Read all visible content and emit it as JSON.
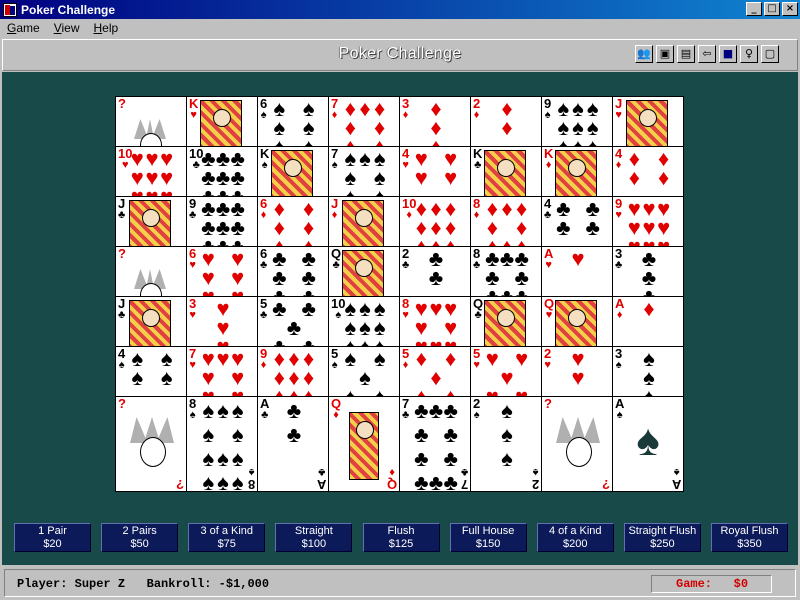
{
  "window": {
    "title": "Poker Challenge"
  },
  "menu": [
    "Game",
    "View",
    "Help"
  ],
  "header": {
    "title": "Poker Challenge"
  },
  "toolbar": [
    "players-icon",
    "cards-icon",
    "notepad-icon",
    "undo-icon",
    "save-icon",
    "hint-icon",
    "exit-icon"
  ],
  "cards": [
    [
      "?",
      "K♥",
      "6♠",
      "7♦",
      "3♦",
      "2♦",
      "9♠",
      "J♥"
    ],
    [
      "10♥",
      "10♣",
      "K♠",
      "7♠",
      "4♥",
      "K♣",
      "K♦",
      "4♦"
    ],
    [
      "J♣",
      "9♣",
      "6♦",
      "J♦",
      "10♦",
      "8♦",
      "4♣",
      "9♥"
    ],
    [
      "?",
      "6♥",
      "6♣",
      "Q♣",
      "2♣",
      "8♣",
      "A♥",
      "3♣"
    ],
    [
      "J♣",
      "3♥",
      "5♣",
      "10♠",
      "8♥",
      "Q♣",
      "Q♥",
      "A♦"
    ],
    [
      "4♠",
      "7♥",
      "9♦",
      "5♠",
      "5♦",
      "5♥",
      "2♥",
      "3♠"
    ],
    [
      "?",
      "8♠",
      "A♣",
      "Q♦",
      "7♣",
      "2♠",
      "?",
      "A♠"
    ]
  ],
  "hands": [
    {
      "name": "1 Pair",
      "payout": "$20"
    },
    {
      "name": "2 Pairs",
      "payout": "$50"
    },
    {
      "name": "3 of a Kind",
      "payout": "$75"
    },
    {
      "name": "Straight",
      "payout": "$100"
    },
    {
      "name": "Flush",
      "payout": "$125"
    },
    {
      "name": "Full House",
      "payout": "$150"
    },
    {
      "name": "4 of a Kind",
      "payout": "$200"
    },
    {
      "name": "Straight Flush",
      "payout": "$250"
    },
    {
      "name": "Royal Flush",
      "payout": "$350"
    }
  ],
  "status": {
    "player_label": "Player:",
    "player_name": "Super Z",
    "bankroll_label": "Bankroll:",
    "bankroll_value": "-$1,000",
    "game_label": "Game:",
    "game_value": "$0"
  }
}
